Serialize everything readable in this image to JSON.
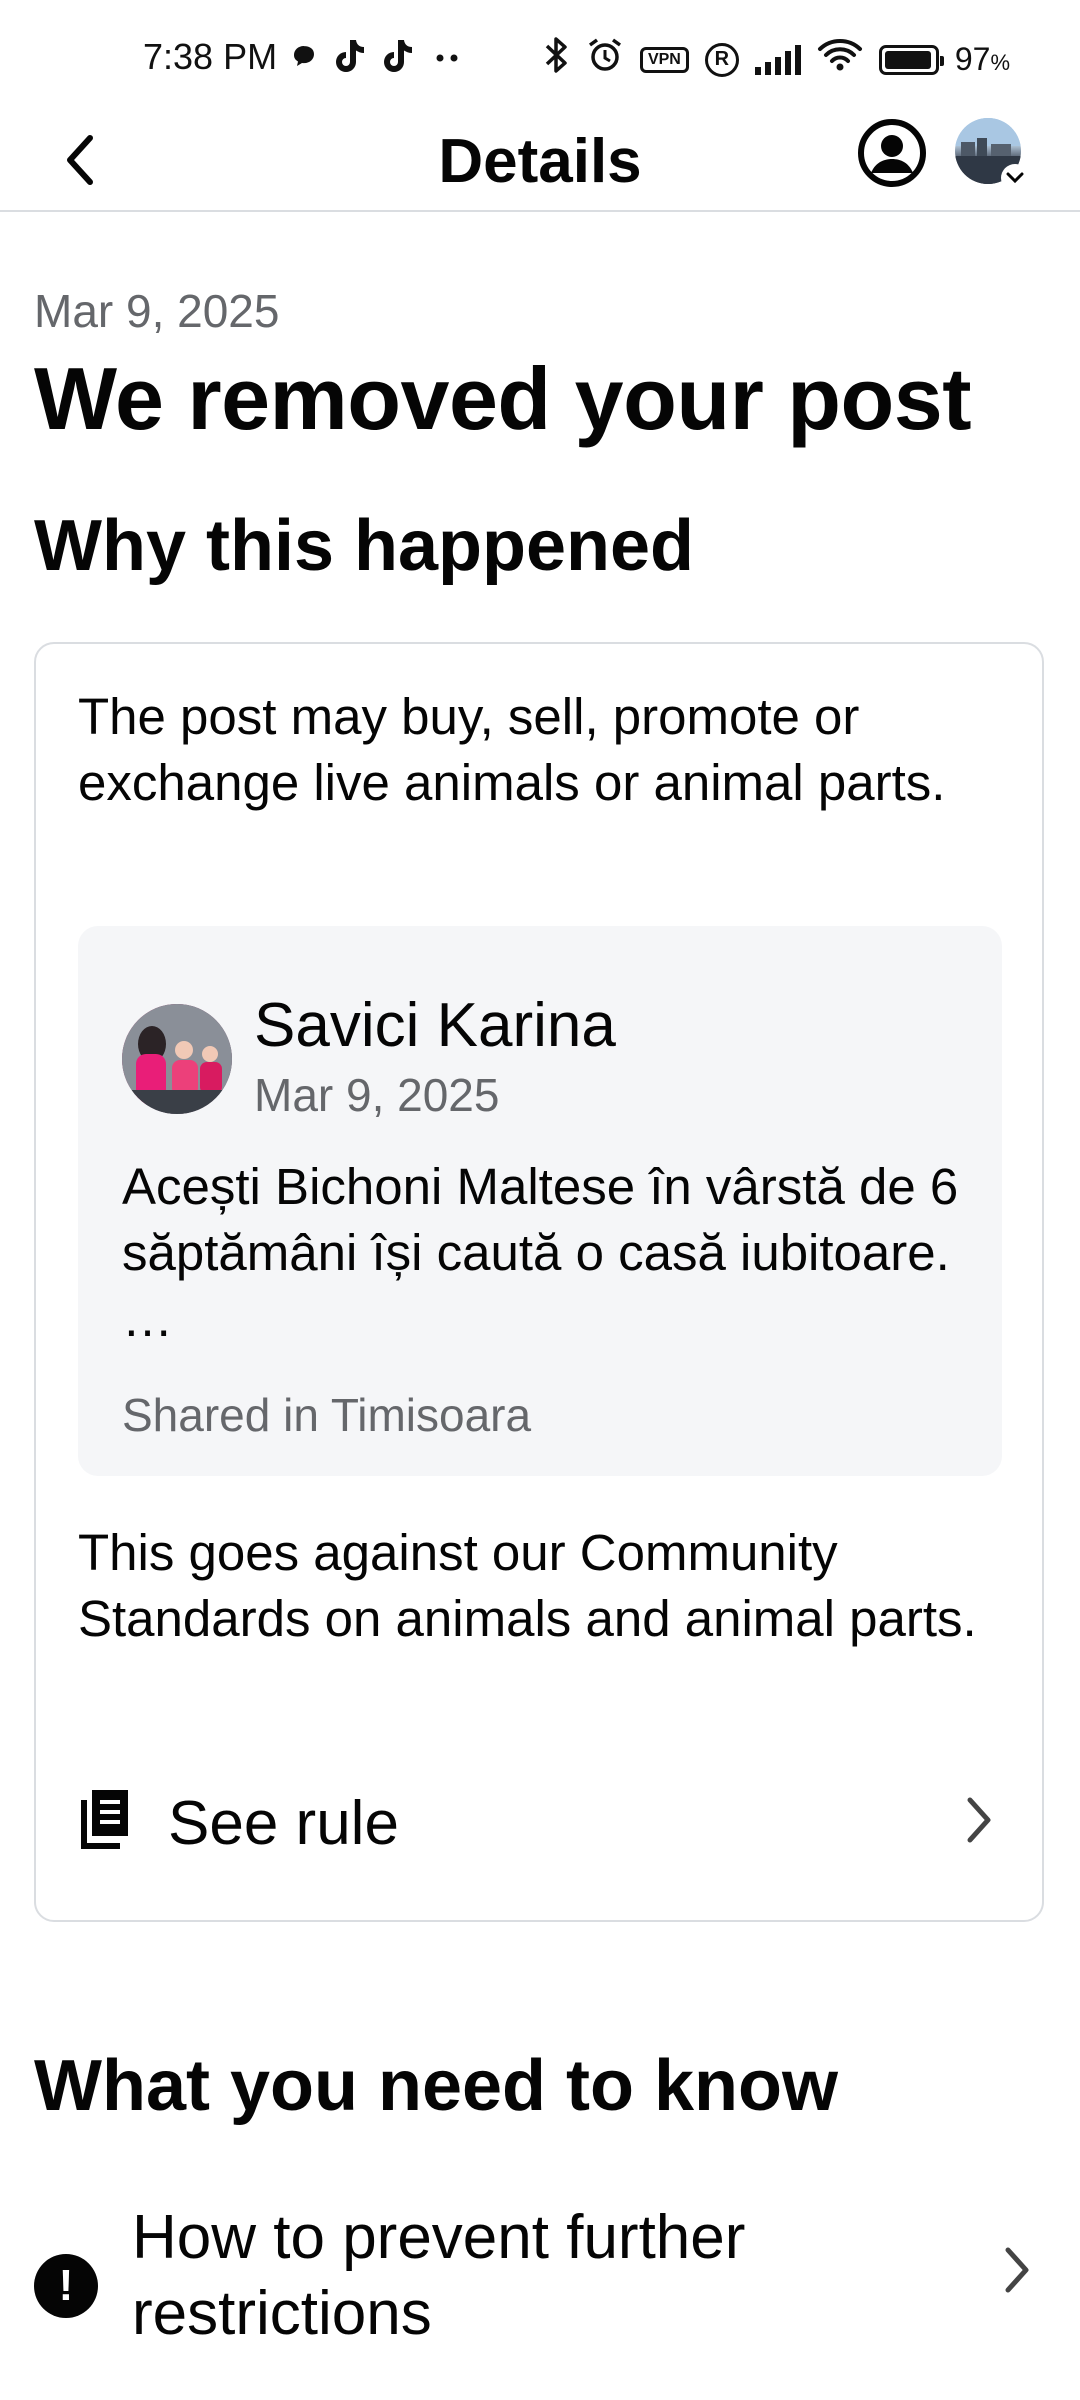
{
  "status_bar": {
    "time": "7:38 PM",
    "left_icons": [
      "chat-bubble-icon",
      "tiktok-icon",
      "tiktok-icon",
      "more-dots-icon"
    ],
    "right_icons": [
      "bluetooth-icon",
      "alarm-icon",
      "vpn-icon",
      "registered-icon",
      "signal-icon",
      "wifi-icon",
      "battery-icon"
    ],
    "vpn_label": "VPN",
    "registered_label": "R",
    "battery_percent": "97",
    "battery_unit": "%",
    "battery_level": 0.97
  },
  "header": {
    "title": "Details",
    "back_icon": "chevron-left-icon",
    "profile_icon": "person-circle-icon"
  },
  "main": {
    "date": "Mar 9, 2025",
    "headline": "We removed your post",
    "why_title": "Why this happened",
    "reason": "The post may buy, sell, promote or exchange live animals or animal parts.",
    "post": {
      "author": "Savici Karina",
      "date": "Mar 9, 2025",
      "text": "Acești Bichoni Maltese în vârstă de 6 săptămâni își caută o casă iubitoare. …",
      "shared_in": "Shared in Timisoara"
    },
    "standard_text": "This goes against our Community Standards on animals and animal parts.",
    "see_rule_label": "See rule",
    "know_title": "What you need to know",
    "prevent_label": "How to prevent further restrictions"
  },
  "colors": {
    "text_primary": "#050505",
    "text_secondary": "#65676b",
    "divider": "#dadde1",
    "preview_bg": "#f5f6f8"
  }
}
